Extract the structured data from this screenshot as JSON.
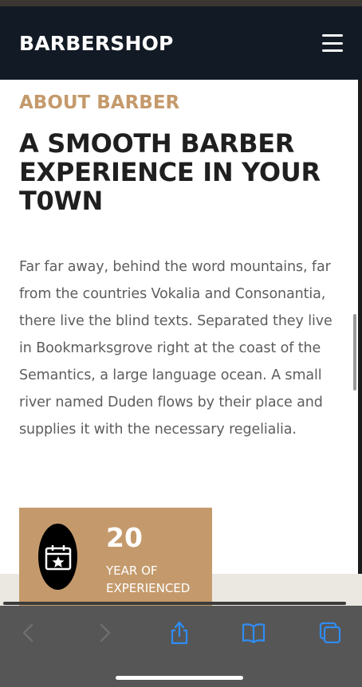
{
  "header": {
    "brand": "BARBERSHOP",
    "menu_icon": "hamburger-menu-icon"
  },
  "about": {
    "eyebrow": "ABOUT BARBER",
    "headline": "A SMOOTH BARBER EXPERIENCE IN YOUR T0WN",
    "body": "Far far away, behind the word mountains, far from the countries Vokalia and Consonantia, there live the blind texts. Separated they live in Bookmarksgrove right at the coast of the Semantics, a large language ocean. A small river named Duden flows by their place and supplies it with the necessary regelialia."
  },
  "stat": {
    "icon": "calendar-star-icon",
    "number": "20",
    "label": "YEAR OF EXPERIENCED"
  },
  "browser_toolbar": {
    "buttons": [
      "back-icon",
      "forward-icon",
      "share-icon",
      "bookmarks-icon",
      "tabs-icon"
    ]
  },
  "colors": {
    "nav_bg": "#121a25",
    "accent": "#c49a6c",
    "headline": "#1f1f1f",
    "body_text": "#5d5d5d",
    "toolbar_bg": "#565656",
    "ios_blue": "#2f8df6"
  }
}
